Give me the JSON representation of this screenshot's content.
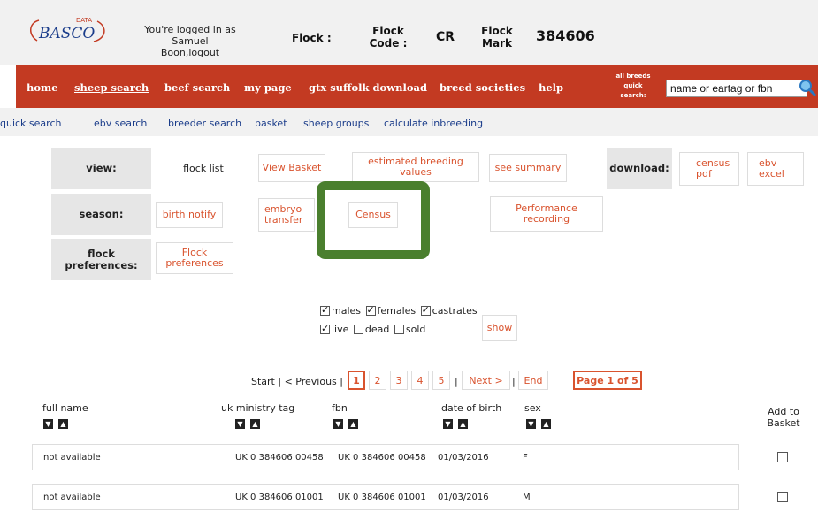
{
  "header": {
    "logo_text": "BASCO",
    "logo_super": "DATA",
    "logged_in": "You're logged in as Samuel",
    "logged_in_line2": "Boon,logout",
    "flock_label": "Flock :",
    "flock_code_label": "Flock Code :",
    "flock_code_value": "CR",
    "flock_mark_label": "Flock Mark",
    "flock_mark_value": "384606"
  },
  "nav": {
    "items": [
      "home",
      "sheep search",
      "beef search",
      "my page",
      "gtx suffolk download",
      "breed societies",
      "help"
    ],
    "quick_search_label_1": "all breeds",
    "quick_search_label_2": "quick",
    "quick_search_label_3": "search:",
    "search_placeholder": "name or eartag or fbn"
  },
  "subnav": {
    "items": [
      "quick search",
      "ebv search",
      "breeder search",
      "basket",
      "sheep groups",
      "calculate inbreeding"
    ]
  },
  "grid": {
    "view_label": "view:",
    "flock_list": "flock list",
    "view_basket": "View Basket",
    "ebv": "estimated breeding values",
    "see_summary": "see summary",
    "download_label": "download:",
    "census_pdf": "census pdf",
    "ebv_excel": "ebv excel",
    "season_label": "season:",
    "birth_notify": "birth notify",
    "embryo_transfer": "embryo transfer",
    "census": "Census",
    "performance_recording": "Performance recording",
    "flock_pref_label": "flock preferences:",
    "flock_pref_button": "Flock preferences"
  },
  "filters": {
    "males": "males",
    "females": "females",
    "castrates": "castrates",
    "live": "live",
    "dead": "dead",
    "sold": "sold",
    "show": "show"
  },
  "pagination": {
    "start": "Start | < Previous |",
    "pages": [
      "1",
      "2",
      "3",
      "4",
      "5"
    ],
    "sep": "|",
    "next": "Next >",
    "sep2": "|",
    "end": "End",
    "page_of": "Page 1 of 5"
  },
  "table": {
    "headers": [
      "full name",
      "uk ministry tag",
      "fbn",
      "date of birth",
      "sex",
      "Add to Basket"
    ],
    "rows": [
      {
        "name": "not available",
        "tag": "UK 0 384606 00458",
        "fbn": "UK 0 384606 00458",
        "dob": "01/03/2016",
        "sex": "F"
      },
      {
        "name": "not available",
        "tag": "UK 0 384606 01001",
        "fbn": "UK 0 384606 01001",
        "dob": "01/03/2016",
        "sex": "M"
      }
    ]
  }
}
